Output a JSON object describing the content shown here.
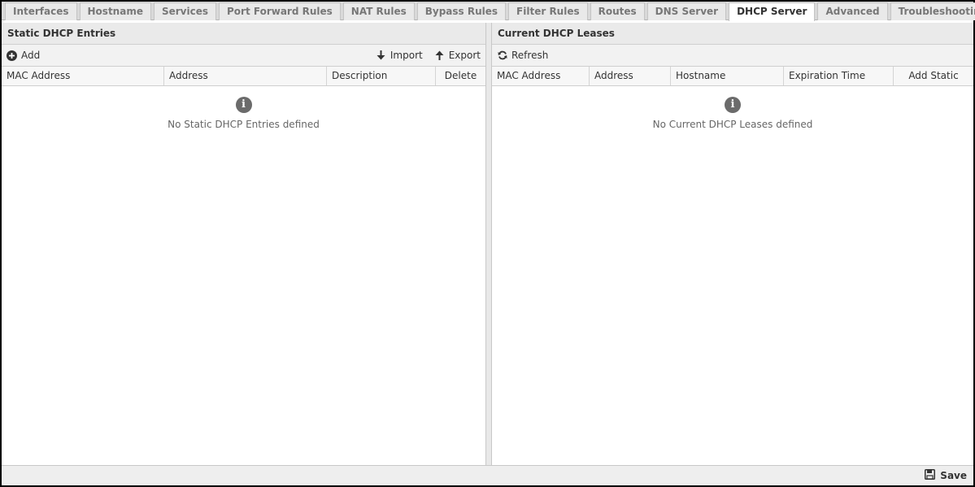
{
  "tabs": [
    {
      "label": "Interfaces",
      "active": false
    },
    {
      "label": "Hostname",
      "active": false
    },
    {
      "label": "Services",
      "active": false
    },
    {
      "label": "Port Forward Rules",
      "active": false
    },
    {
      "label": "NAT Rules",
      "active": false
    },
    {
      "label": "Bypass Rules",
      "active": false
    },
    {
      "label": "Filter Rules",
      "active": false
    },
    {
      "label": "Routes",
      "active": false
    },
    {
      "label": "DNS Server",
      "active": false
    },
    {
      "label": "DHCP Server",
      "active": true
    },
    {
      "label": "Advanced",
      "active": false
    },
    {
      "label": "Troubleshooting",
      "active": false
    }
  ],
  "static_panel": {
    "title": "Static DHCP Entries",
    "add_label": "Add",
    "import_label": "Import",
    "export_label": "Export",
    "columns": [
      "MAC Address",
      "Address",
      "Description",
      "Delete"
    ],
    "empty_message": "No Static DHCP Entries defined"
  },
  "leases_panel": {
    "title": "Current DHCP Leases",
    "refresh_label": "Refresh",
    "columns": [
      "MAC Address",
      "Address",
      "Hostname",
      "Expiration Time",
      "Add Static"
    ],
    "empty_message": "No Current DHCP Leases defined"
  },
  "footer": {
    "save_label": "Save"
  },
  "icons": {
    "add": "plus-circle-icon",
    "import": "arrow-down-icon",
    "export": "arrow-up-icon",
    "refresh": "refresh-icon",
    "info": "info-icon",
    "save": "floppy-disk-icon"
  }
}
